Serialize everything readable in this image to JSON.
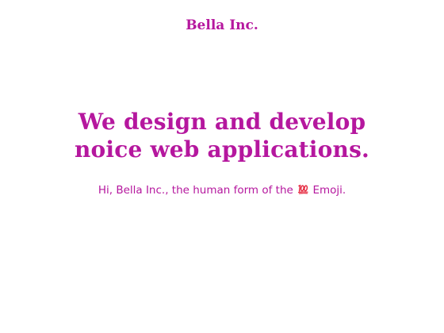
{
  "header": {
    "brand": "Bella Inc."
  },
  "hero": {
    "headline_line1": "We design and develop",
    "headline_line2": "noice web applications.",
    "tagline_before": "Hi, Bella Inc., the human form of the",
    "tagline_emoji": "hundred-points-icon",
    "tagline_after": "Emoji."
  },
  "colors": {
    "accent": "#b5179e",
    "background": "#ffffff",
    "emoji_red": "#e5243b"
  }
}
